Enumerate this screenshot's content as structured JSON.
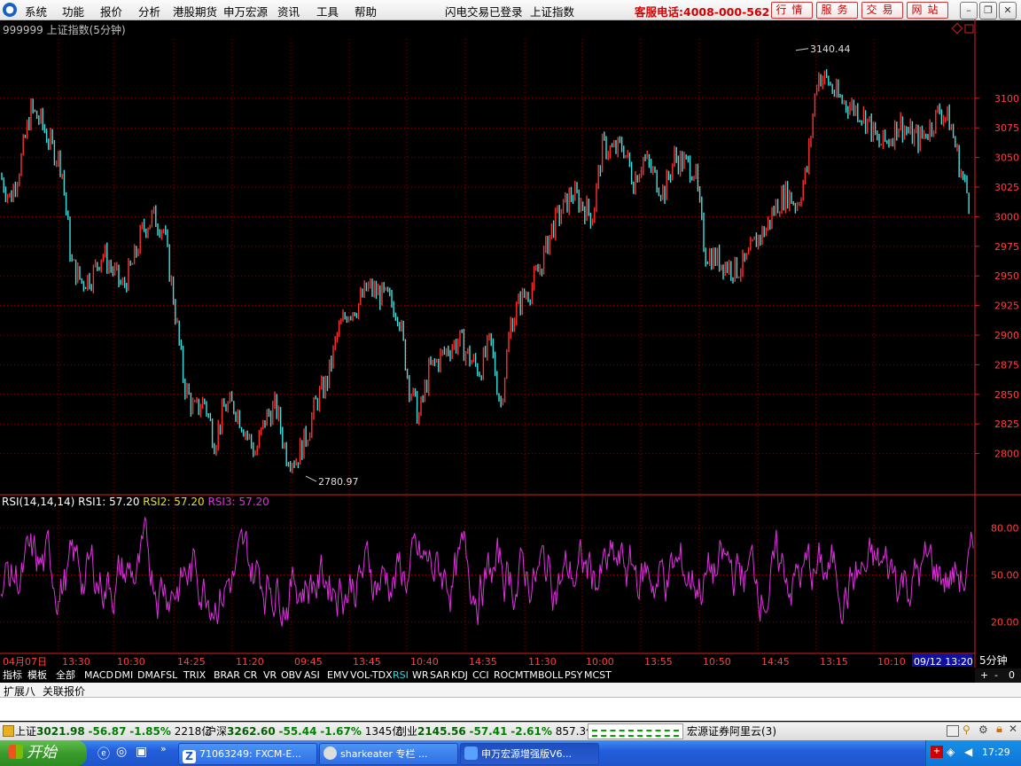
{
  "menubar": {
    "items": [
      "系统",
      "功能",
      "报价",
      "分析",
      "港股期货",
      "申万宏源",
      "资讯",
      "工具",
      "帮助"
    ],
    "login_status": "闪电交易已登录",
    "index_name": "上证指数",
    "hotline": "客服电话:4008-000-562",
    "buttons": [
      "行情",
      "服务",
      "交易",
      "网站"
    ]
  },
  "chart": {
    "info": "999999 上证指数(5分钟)",
    "colors": {
      "up": "#ff3030",
      "down": "#40e0e0",
      "grid": "#8a0000",
      "axis": "#d82020",
      "rsi": "#e030e0",
      "label_red": "#ff4040"
    },
    "high_label": "3140.44",
    "low_label": "2780.97",
    "price_ticks": [
      "3100",
      "3075",
      "3050",
      "3025",
      "3000",
      "2975",
      "2950",
      "2925",
      "2900",
      "2875",
      "2850",
      "2825",
      "2800"
    ],
    "rsi_legend": {
      "name": "RSI(14,14,14)",
      "rsi1": "RSI1: 57.20",
      "rsi2": "RSI2: 57.20",
      "rsi3": "RSI3: 57.20"
    },
    "rsi_ticks": [
      "80.00",
      "50.00",
      "20.00"
    ],
    "x_labels": [
      "04月07日",
      "13:30",
      "10:30",
      "14:25",
      "11:20",
      "09:45",
      "13:45",
      "10:40",
      "14:35",
      "11:30",
      "10:00",
      "13:55",
      "10:50",
      "14:45",
      "13:15",
      "10:10"
    ],
    "current_label": "09/12 13:20",
    "period": "5分钟"
  },
  "chart_data": {
    "type": "line",
    "title": "999999 上证指数(5分钟)",
    "price": {
      "high": 3140.44,
      "low": 2780.97,
      "ylim": [
        2775,
        3150
      ],
      "series": [
        3035,
        3015,
        3045,
        3090,
        3080,
        3060,
        3045,
        2960,
        2945,
        2950,
        2970,
        2955,
        2940,
        2960,
        2990,
        3000,
        2990,
        2930,
        2860,
        2835,
        2845,
        2810,
        2840,
        2840,
        2820,
        2800,
        2830,
        2840,
        2800,
        2795,
        2815,
        2845,
        2860,
        2900,
        2920,
        2925,
        2940,
        2935,
        2930,
        2920,
        2860,
        2830,
        2870,
        2880,
        2890,
        2895,
        2880,
        2870,
        2895,
        2840,
        2910,
        2930,
        2940,
        2960,
        2990,
        3005,
        3020,
        3010,
        3000,
        3060,
        3055,
        3060,
        3030,
        3050,
        3035,
        3020,
        3050,
        3045,
        3040,
        2970,
        2965,
        2960,
        2955,
        2960,
        2980,
        2990,
        3010,
        3020,
        3010,
        3040,
        3120,
        3115,
        3100,
        3095,
        3090,
        3080,
        3060,
        3065,
        3080,
        3070,
        3065,
        3075,
        3090,
        3080,
        3040,
        3010
      ]
    },
    "rsi": {
      "value": 57.2,
      "ylim": [
        0,
        100
      ]
    }
  },
  "tabs": {
    "items": [
      "指标",
      "模板",
      "全部",
      "MACD",
      "DMI",
      "DMA",
      "FSL",
      "TRIX",
      "BRAR",
      "CR",
      "VR",
      "OBV",
      "ASI",
      "EMV",
      "VOL-TDX",
      "RSI",
      "WR",
      "SAR",
      "KDJ",
      "CCI",
      "ROC",
      "MTM",
      "BOLL",
      "PSY",
      "MCST"
    ],
    "active": "RSI",
    "controls": [
      "+",
      "-",
      "0"
    ],
    "ext": [
      "扩展八",
      "关联报价"
    ]
  },
  "status": {
    "sh_label": "上证",
    "sh_value": "3021.98",
    "sh_change": "-56.87",
    "sh_pct": "-1.85%",
    "sh_amount": "2218亿",
    "hs_label": "沪深",
    "hs_value": "3262.60",
    "hs_change": "-55.44",
    "hs_pct": "-1.67%",
    "hs_amount": "1345亿",
    "cy_label": "创业",
    "cy_value": "2145.56",
    "cy_change": "-57.41",
    "cy_pct": "-2.61%",
    "cy_amount": "857.3亿",
    "broker": "宏源证券阿里云(3)"
  },
  "taskbar": {
    "start": "开始",
    "tasks": [
      "71063249: FXCM-E...",
      "sharkeater 专栏 ...",
      "申万宏源增强版V6..."
    ],
    "clock": "17:29"
  }
}
